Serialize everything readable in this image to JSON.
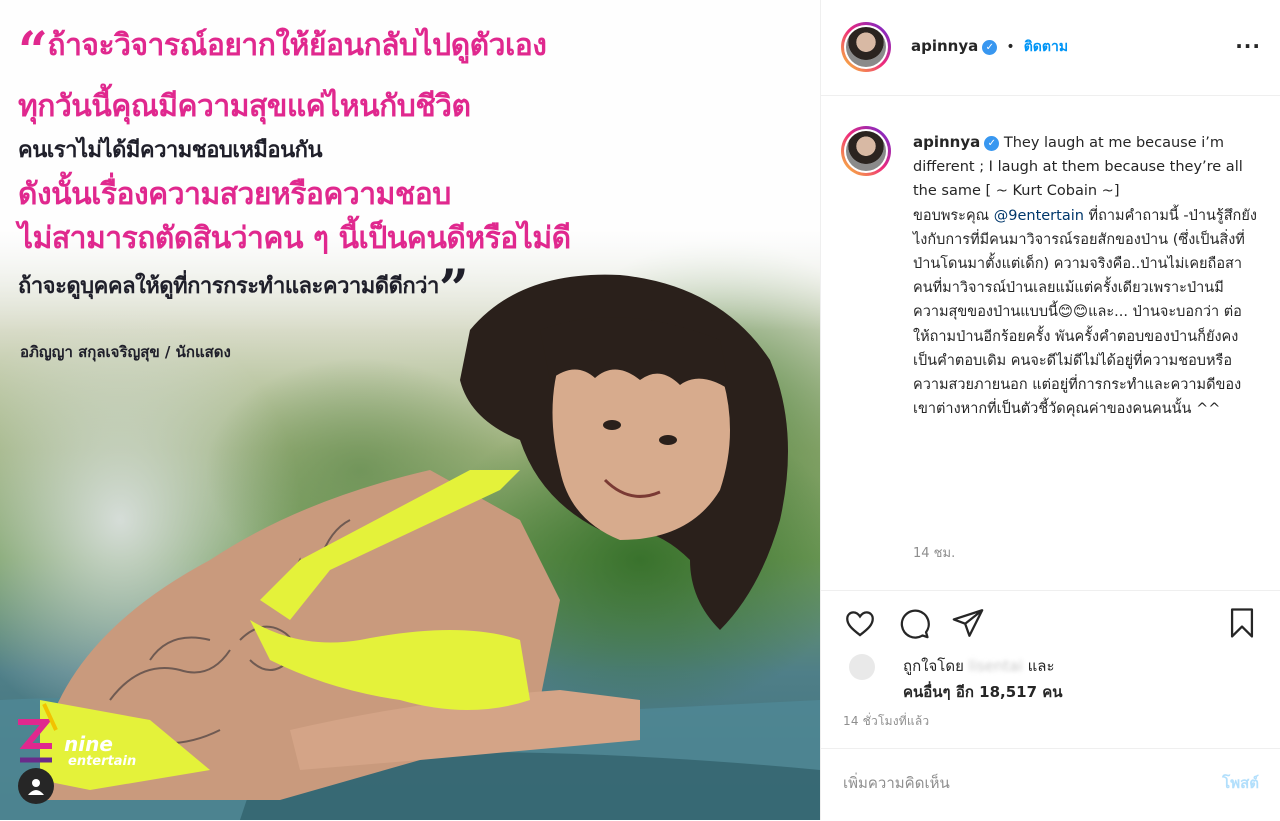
{
  "post_image": {
    "quote_lines": [
      "ถ้าจะวิจารณ์อยากให้ย้อนกลับไปดูตัวเอง",
      "ทุกวันนี้คุณมีความสุขแค่ไหนกับชีวิต",
      "คนเราไม่ได้มีความชอบเหมือนกัน",
      "ดังนั้นเรื่องความสวยหรือความชอบ",
      "ไม่สามารถตัดสินว่าคน ๆ นี้เป็นคนดีหรือไม่ดี",
      "ถ้าจะดูบุคคลให้ดูที่การกระทำและความดีดีกว่า"
    ],
    "open_quote": "“",
    "close_quote": "”",
    "credit": "อภิญญา สกุลเจริญสุข / นักแสดง",
    "brand_line1": "nine",
    "brand_line2": "entertain",
    "colors": {
      "pink": "#e0288e",
      "dark_text": "#1f1f2a",
      "bikini": "#e4f23a"
    }
  },
  "header": {
    "username": "apinnya",
    "verified_icon": "verified-badge-icon",
    "separator": "•",
    "follow_label": "ติดตาม",
    "more_label": "···"
  },
  "caption": {
    "username": "apinnya",
    "text_en": "They laugh at me because i’m different ; I laugh at them because they’re all the same [ ~ Kurt Cobain ~]",
    "text_th_before": "ขอบพระคุณ ",
    "mention": "@9entertain",
    "text_th_after": " ที่ถามคำถามนี้ -ป่านรู้สึกยังไงกับการที่มีคนมาวิจารณ์รอยสักของป่าน (ซึ่งเป็นสิ่งที่ป่านโดนมาตั้งแต่เด็ก) ความจริงคือ..ป่านไม่เคยถือสาคนที่มาวิจารณ์ป่านเลยแม้แต่ครั้งเดียวเพราะป่านมีความสุขของป่านแบบนี้😊😊และ... ป่านจะบอกว่า ต่อให้ถามป่านอีกร้อยครั้ง พันครั้งคำตอบของป่านก็ยังคงเป็นคำตอบเดิม คนจะดีไม่ดีไม่ได้อยู่ที่ความชอบหรือความสวยภายนอก แต่อยู่ที่การกระทำและความดีของเขาต่างหากที่เป็นตัวชี้วัดคุณค่าของคนคนนั้น ^^",
    "time": "14 ชม."
  },
  "actions": {
    "like_icon": "heart-icon",
    "comment_icon": "comment-icon",
    "share_icon": "share-icon",
    "save_icon": "bookmark-icon"
  },
  "likes": {
    "prefix": "ถูกใจโดย",
    "liker": "lisentai",
    "and": "และ",
    "others": "คนอื่นๆ อีก 18,517 คน"
  },
  "posted_ago": "14 ชั่วโมงที่แล้ว",
  "comment": {
    "placeholder": "เพิ่มความคิดเห็น",
    "post_label": "โพสต์"
  }
}
